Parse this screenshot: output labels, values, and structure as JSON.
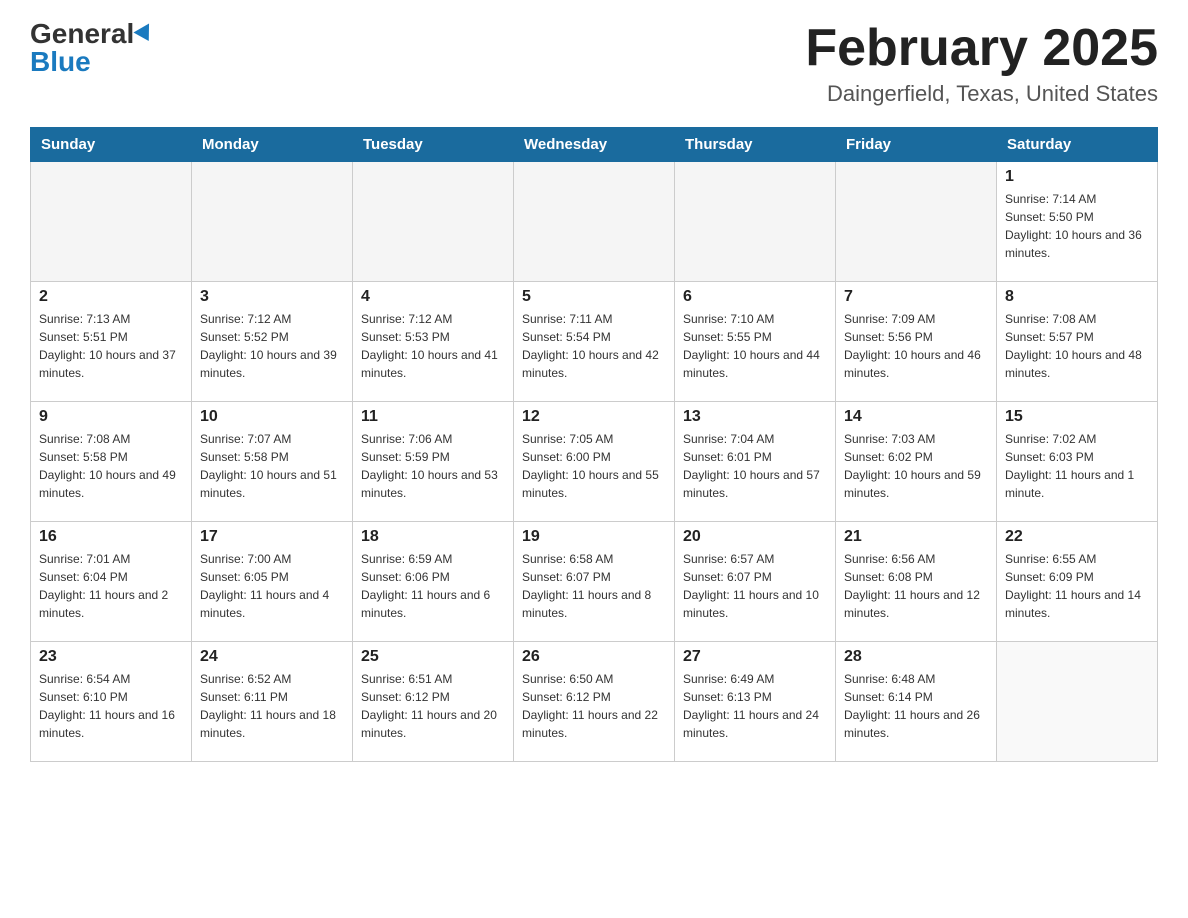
{
  "logo": {
    "general": "General",
    "blue": "Blue"
  },
  "header": {
    "month": "February 2025",
    "location": "Daingerfield, Texas, United States"
  },
  "days_of_week": [
    "Sunday",
    "Monday",
    "Tuesday",
    "Wednesday",
    "Thursday",
    "Friday",
    "Saturday"
  ],
  "weeks": [
    [
      {
        "day": "",
        "sunrise": "",
        "sunset": "",
        "daylight": "",
        "empty": true
      },
      {
        "day": "",
        "sunrise": "",
        "sunset": "",
        "daylight": "",
        "empty": true
      },
      {
        "day": "",
        "sunrise": "",
        "sunset": "",
        "daylight": "",
        "empty": true
      },
      {
        "day": "",
        "sunrise": "",
        "sunset": "",
        "daylight": "",
        "empty": true
      },
      {
        "day": "",
        "sunrise": "",
        "sunset": "",
        "daylight": "",
        "empty": true
      },
      {
        "day": "",
        "sunrise": "",
        "sunset": "",
        "daylight": "",
        "empty": true
      },
      {
        "day": "1",
        "sunrise": "Sunrise: 7:14 AM",
        "sunset": "Sunset: 5:50 PM",
        "daylight": "Daylight: 10 hours and 36 minutes.",
        "empty": false
      }
    ],
    [
      {
        "day": "2",
        "sunrise": "Sunrise: 7:13 AM",
        "sunset": "Sunset: 5:51 PM",
        "daylight": "Daylight: 10 hours and 37 minutes.",
        "empty": false
      },
      {
        "day": "3",
        "sunrise": "Sunrise: 7:12 AM",
        "sunset": "Sunset: 5:52 PM",
        "daylight": "Daylight: 10 hours and 39 minutes.",
        "empty": false
      },
      {
        "day": "4",
        "sunrise": "Sunrise: 7:12 AM",
        "sunset": "Sunset: 5:53 PM",
        "daylight": "Daylight: 10 hours and 41 minutes.",
        "empty": false
      },
      {
        "day": "5",
        "sunrise": "Sunrise: 7:11 AM",
        "sunset": "Sunset: 5:54 PM",
        "daylight": "Daylight: 10 hours and 42 minutes.",
        "empty": false
      },
      {
        "day": "6",
        "sunrise": "Sunrise: 7:10 AM",
        "sunset": "Sunset: 5:55 PM",
        "daylight": "Daylight: 10 hours and 44 minutes.",
        "empty": false
      },
      {
        "day": "7",
        "sunrise": "Sunrise: 7:09 AM",
        "sunset": "Sunset: 5:56 PM",
        "daylight": "Daylight: 10 hours and 46 minutes.",
        "empty": false
      },
      {
        "day": "8",
        "sunrise": "Sunrise: 7:08 AM",
        "sunset": "Sunset: 5:57 PM",
        "daylight": "Daylight: 10 hours and 48 minutes.",
        "empty": false
      }
    ],
    [
      {
        "day": "9",
        "sunrise": "Sunrise: 7:08 AM",
        "sunset": "Sunset: 5:58 PM",
        "daylight": "Daylight: 10 hours and 49 minutes.",
        "empty": false
      },
      {
        "day": "10",
        "sunrise": "Sunrise: 7:07 AM",
        "sunset": "Sunset: 5:58 PM",
        "daylight": "Daylight: 10 hours and 51 minutes.",
        "empty": false
      },
      {
        "day": "11",
        "sunrise": "Sunrise: 7:06 AM",
        "sunset": "Sunset: 5:59 PM",
        "daylight": "Daylight: 10 hours and 53 minutes.",
        "empty": false
      },
      {
        "day": "12",
        "sunrise": "Sunrise: 7:05 AM",
        "sunset": "Sunset: 6:00 PM",
        "daylight": "Daylight: 10 hours and 55 minutes.",
        "empty": false
      },
      {
        "day": "13",
        "sunrise": "Sunrise: 7:04 AM",
        "sunset": "Sunset: 6:01 PM",
        "daylight": "Daylight: 10 hours and 57 minutes.",
        "empty": false
      },
      {
        "day": "14",
        "sunrise": "Sunrise: 7:03 AM",
        "sunset": "Sunset: 6:02 PM",
        "daylight": "Daylight: 10 hours and 59 minutes.",
        "empty": false
      },
      {
        "day": "15",
        "sunrise": "Sunrise: 7:02 AM",
        "sunset": "Sunset: 6:03 PM",
        "daylight": "Daylight: 11 hours and 1 minute.",
        "empty": false
      }
    ],
    [
      {
        "day": "16",
        "sunrise": "Sunrise: 7:01 AM",
        "sunset": "Sunset: 6:04 PM",
        "daylight": "Daylight: 11 hours and 2 minutes.",
        "empty": false
      },
      {
        "day": "17",
        "sunrise": "Sunrise: 7:00 AM",
        "sunset": "Sunset: 6:05 PM",
        "daylight": "Daylight: 11 hours and 4 minutes.",
        "empty": false
      },
      {
        "day": "18",
        "sunrise": "Sunrise: 6:59 AM",
        "sunset": "Sunset: 6:06 PM",
        "daylight": "Daylight: 11 hours and 6 minutes.",
        "empty": false
      },
      {
        "day": "19",
        "sunrise": "Sunrise: 6:58 AM",
        "sunset": "Sunset: 6:07 PM",
        "daylight": "Daylight: 11 hours and 8 minutes.",
        "empty": false
      },
      {
        "day": "20",
        "sunrise": "Sunrise: 6:57 AM",
        "sunset": "Sunset: 6:07 PM",
        "daylight": "Daylight: 11 hours and 10 minutes.",
        "empty": false
      },
      {
        "day": "21",
        "sunrise": "Sunrise: 6:56 AM",
        "sunset": "Sunset: 6:08 PM",
        "daylight": "Daylight: 11 hours and 12 minutes.",
        "empty": false
      },
      {
        "day": "22",
        "sunrise": "Sunrise: 6:55 AM",
        "sunset": "Sunset: 6:09 PM",
        "daylight": "Daylight: 11 hours and 14 minutes.",
        "empty": false
      }
    ],
    [
      {
        "day": "23",
        "sunrise": "Sunrise: 6:54 AM",
        "sunset": "Sunset: 6:10 PM",
        "daylight": "Daylight: 11 hours and 16 minutes.",
        "empty": false
      },
      {
        "day": "24",
        "sunrise": "Sunrise: 6:52 AM",
        "sunset": "Sunset: 6:11 PM",
        "daylight": "Daylight: 11 hours and 18 minutes.",
        "empty": false
      },
      {
        "day": "25",
        "sunrise": "Sunrise: 6:51 AM",
        "sunset": "Sunset: 6:12 PM",
        "daylight": "Daylight: 11 hours and 20 minutes.",
        "empty": false
      },
      {
        "day": "26",
        "sunrise": "Sunrise: 6:50 AM",
        "sunset": "Sunset: 6:12 PM",
        "daylight": "Daylight: 11 hours and 22 minutes.",
        "empty": false
      },
      {
        "day": "27",
        "sunrise": "Sunrise: 6:49 AM",
        "sunset": "Sunset: 6:13 PM",
        "daylight": "Daylight: 11 hours and 24 minutes.",
        "empty": false
      },
      {
        "day": "28",
        "sunrise": "Sunrise: 6:48 AM",
        "sunset": "Sunset: 6:14 PM",
        "daylight": "Daylight: 11 hours and 26 minutes.",
        "empty": false
      },
      {
        "day": "",
        "sunrise": "",
        "sunset": "",
        "daylight": "",
        "empty": true
      }
    ]
  ]
}
